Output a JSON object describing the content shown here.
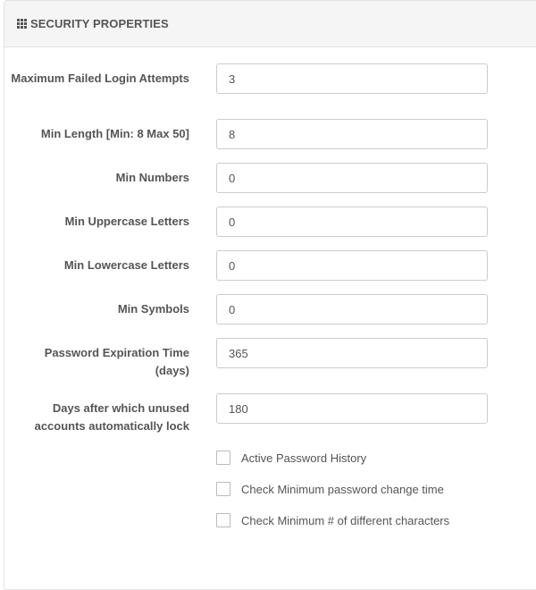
{
  "panel": {
    "icon": "grid-icon",
    "title": "SECURITY PROPERTIES"
  },
  "fields": [
    {
      "label": "Maximum Failed Login Attempts",
      "value": "3"
    },
    {
      "label": "Min Length [Min: 8 Max 50]",
      "value": "8"
    },
    {
      "label": "Min Numbers",
      "value": "0"
    },
    {
      "label": "Min Uppercase Letters",
      "value": "0"
    },
    {
      "label": "Min Lowercase Letters",
      "value": "0"
    },
    {
      "label": "Min Symbols",
      "value": "0"
    },
    {
      "label": "Password Expiration Time (days)",
      "value": "365"
    },
    {
      "label": "Days after which unused accounts automatically lock",
      "value": "180"
    }
  ],
  "checkboxes": [
    {
      "label": "Active Password History",
      "checked": false
    },
    {
      "label": "Check Minimum password change time",
      "checked": false
    },
    {
      "label": "Check Minimum # of different characters",
      "checked": false
    }
  ]
}
